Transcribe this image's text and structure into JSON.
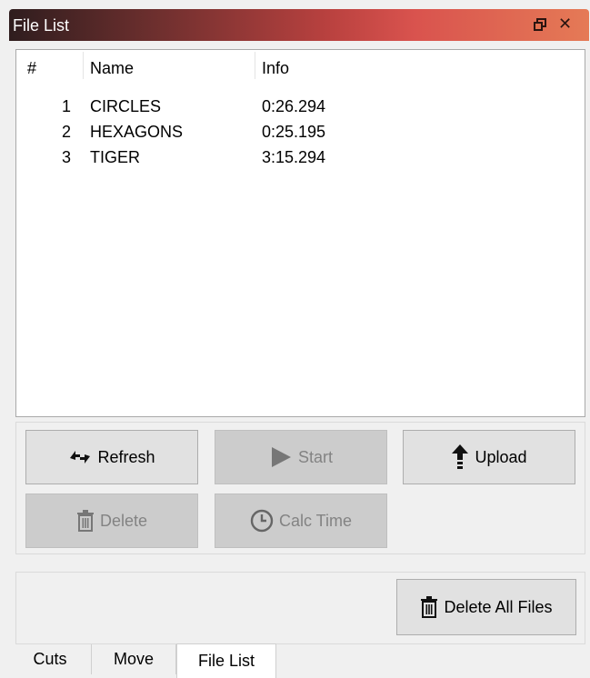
{
  "window": {
    "title": "File List"
  },
  "list": {
    "columns": [
      "#",
      "Name",
      "Info"
    ],
    "rows": [
      {
        "num": "1",
        "name": "CIRCLES",
        "info": "0:26.294"
      },
      {
        "num": "2",
        "name": "HEXAGONS",
        "info": "0:25.195"
      },
      {
        "num": "3",
        "name": "TIGER",
        "info": "3:15.294"
      }
    ]
  },
  "buttons": {
    "refresh": "Refresh",
    "start": "Start",
    "upload": "Upload",
    "delete": "Delete",
    "calc_time": "Calc Time",
    "delete_all": "Delete All Files"
  },
  "tabs": [
    "Cuts",
    "Move",
    "File List"
  ],
  "active_tab": "File List"
}
